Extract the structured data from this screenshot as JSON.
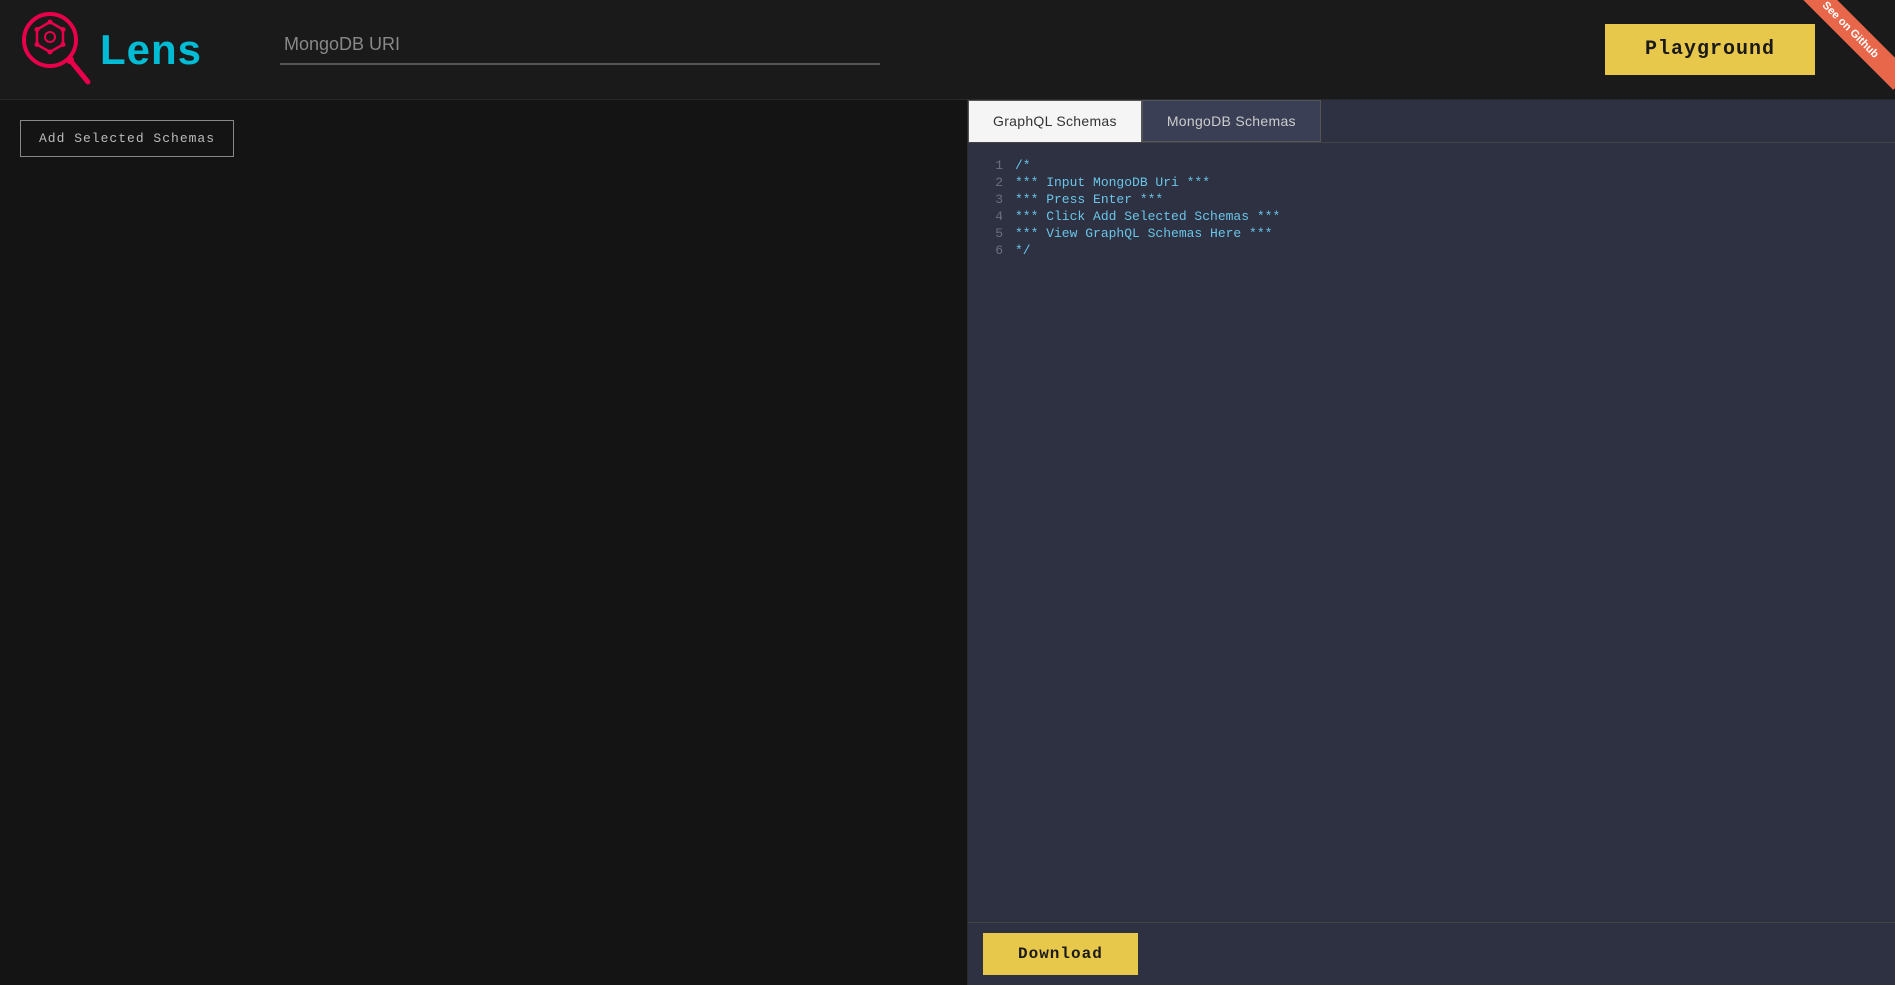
{
  "header": {
    "logo_text": "Lens",
    "uri_placeholder": "MongoDB URI",
    "playground_label": "Playground",
    "github_ribbon_text": "See on Github"
  },
  "sidebar": {
    "add_schemas_label": "Add Selected Schemas"
  },
  "right_panel": {
    "tabs": [
      {
        "id": "graphql",
        "label": "GraphQL Schemas",
        "active": true
      },
      {
        "id": "mongodb",
        "label": "MongoDB Schemas",
        "active": false
      }
    ],
    "code_lines": [
      {
        "number": "1",
        "content": "/*"
      },
      {
        "number": "2",
        "content": "*** Input MongoDB Uri ***"
      },
      {
        "number": "3",
        "content": "*** Press Enter ***"
      },
      {
        "number": "4",
        "content": "*** Click Add Selected Schemas ***"
      },
      {
        "number": "5",
        "content": "*** View GraphQL Schemas Here ***"
      },
      {
        "number": "6",
        "content": "*/"
      }
    ],
    "download_label": "Download"
  },
  "colors": {
    "accent_yellow": "#e8c84a",
    "accent_cyan": "#00bcd4",
    "accent_pink": "#e8004a",
    "code_text": "#6ac5e8",
    "background_dark": "#1a1a1a",
    "panel_bg": "#2d3142",
    "ribbon_color": "#e8674a"
  }
}
